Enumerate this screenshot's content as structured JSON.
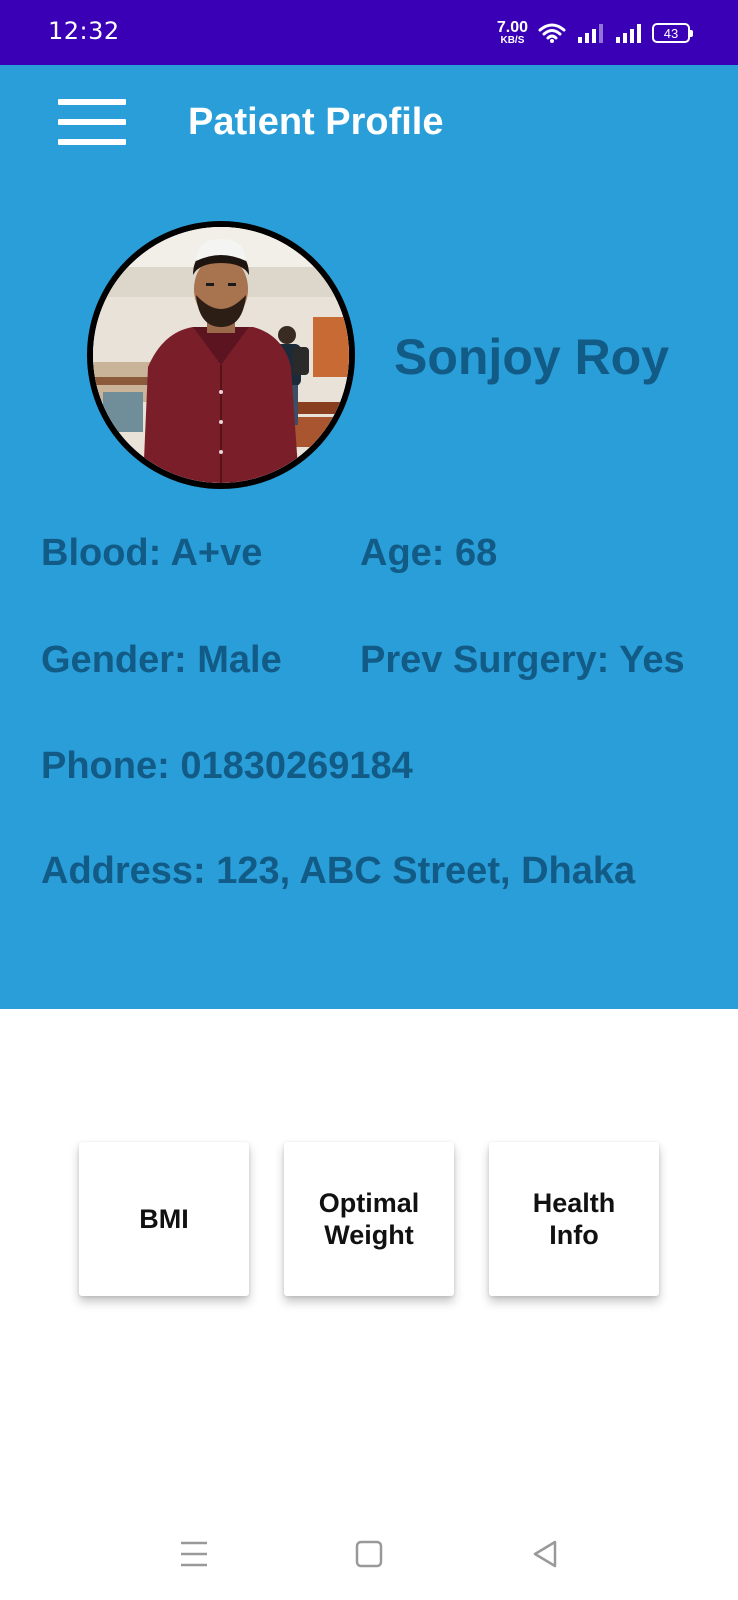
{
  "status_bar": {
    "time": "12:32",
    "net_speed_value": "7.00",
    "net_speed_unit": "KB/S",
    "battery": "43",
    "icons": [
      "wifi-icon",
      "signal-icon",
      "signal-icon",
      "battery-icon"
    ]
  },
  "header": {
    "title": "Patient Profile",
    "menu_icon": "hamburger-menu-icon"
  },
  "profile": {
    "name": "Sonjoy Roy",
    "blood": "Blood: A+ve",
    "age": "Age: 68",
    "gender": "Gender: Male",
    "prev_surgery": "Prev Surgery: Yes",
    "phone": "Phone: 01830269184",
    "address": "Address: 123, ABC Street, Dhaka"
  },
  "actions": {
    "bmi": "BMI",
    "optimal_weight_line1": "Optimal",
    "optimal_weight_line2": "Weight",
    "health_info_line1": "Health",
    "health_info_line2": "Info"
  },
  "colors": {
    "status_bar": "#3a00b5",
    "panel": "#299ed8",
    "text_dark_blue": "#125b86",
    "white": "#ffffff"
  },
  "nav_bar": {
    "icons": [
      "recents-icon",
      "home-icon",
      "back-icon"
    ]
  }
}
